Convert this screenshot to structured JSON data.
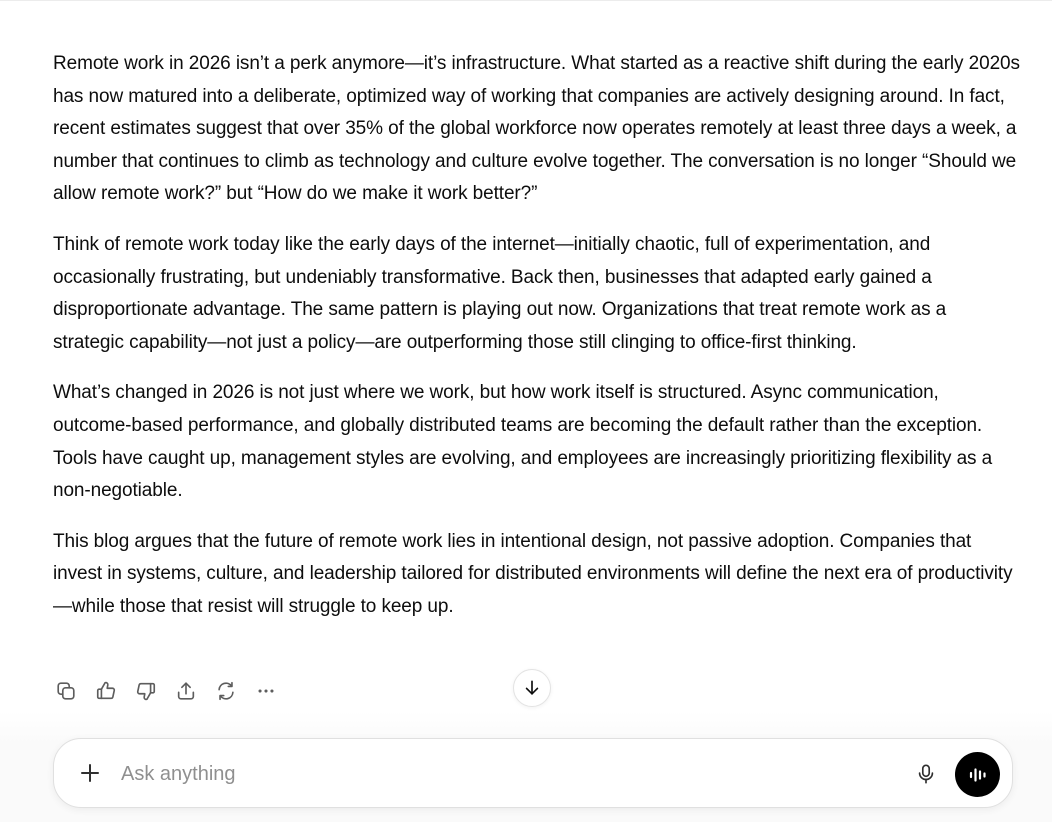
{
  "message": {
    "paragraphs": [
      "Remote work in 2026 isn’t a perk anymore—it’s infrastructure. What started as a reactive shift during the early 2020s has now matured into a deliberate, optimized way of working that companies are actively designing around. In fact, recent estimates suggest that over 35% of the global workforce now operates remotely at least three days a week, a number that continues to climb as technology and culture evolve together. The conversation is no longer “Should we allow remote work?” but “How do we make it work better?”",
      "Think of remote work today like the early days of the internet—initially chaotic, full of experimentation, and occasionally frustrating, but undeniably transformative. Back then, businesses that adapted early gained a disproportionate advantage. The same pattern is playing out now. Organizations that treat remote work as a strategic capability—not just a policy—are outperforming those still clinging to office-first thinking.",
      "What’s changed in 2026 is not just where we work, but how work itself is structured. Async communication, outcome-based performance, and globally distributed teams are becoming the default rather than the exception. Tools have caught up, management styles are evolving, and employees are increasingly prioritizing flexibility as a non-negotiable.",
      "This blog argues that the future of remote work lies in intentional design, not passive adoption. Companies that invest in systems, culture, and leadership tailored for distributed environments will define the next era of productivity—while those that resist will struggle to keep up."
    ]
  },
  "actions": {
    "icons": [
      "copy-icon",
      "thumbs-up-icon",
      "thumbs-down-icon",
      "share-icon",
      "regenerate-icon",
      "more-icon"
    ]
  },
  "scroll": {
    "icon": "arrow-down-icon"
  },
  "composer": {
    "placeholder": "Ask anything",
    "value": "",
    "plus_icon": "plus-icon",
    "mic_icon": "microphone-icon",
    "voice_icon": "voice-waveform-icon"
  },
  "colors": {
    "text": "#0d0d0d",
    "icon": "#5d5d5d",
    "voice_button": "#000000",
    "placeholder": "#8f8f8f"
  }
}
